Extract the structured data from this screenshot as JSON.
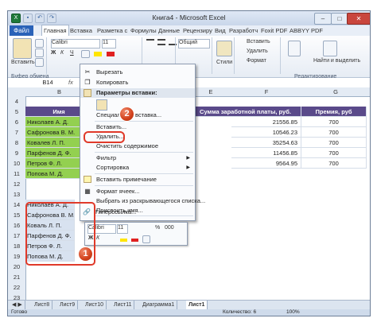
{
  "window": {
    "title": "Книга4 - Microsoft Excel"
  },
  "tabs": {
    "file": "Файл",
    "items": [
      "Главная",
      "Вставка",
      "Разметка с",
      "Формулы",
      "Данные",
      "Рецензиру",
      "Вид",
      "Разработч",
      "Foxit PDF",
      "ABBYY PDF"
    ],
    "active": "Главная"
  },
  "ribbon": {
    "paste_label": "Вставить",
    "clipboard_group": "Буфер обмена",
    "font_name": "Calibri",
    "font_size": "11",
    "number_format": "Общий",
    "styles_label": "Стили",
    "insert_label": "Вставить",
    "delete_label": "Удалить",
    "format_label": "Формат",
    "find_label": "Найти и выделить",
    "editing_group": "Редактирование"
  },
  "formula_bar": {
    "cell_ref": "B14"
  },
  "columns": [
    "B",
    "C",
    "D",
    "E",
    "F",
    "G"
  ],
  "rows": [
    "4",
    "5",
    "6",
    "7",
    "8",
    "9",
    "10",
    "11",
    "12",
    "13",
    "14",
    "15",
    "16",
    "17",
    "18",
    "19",
    "20",
    "21",
    "22",
    "23"
  ],
  "table": {
    "header_name": "Имя",
    "header_salary": "Сумма заработной платы, руб.",
    "header_bonus": "Премия, руб",
    "names": [
      "Николаев А. Д.",
      "Сафронова В. М.",
      "Ковалев Л. П.",
      "Парфенов Д. Ф.",
      "Петров Ф. Л.",
      "Попова М. Д."
    ],
    "salaries": [
      "21556.85",
      "10546.23",
      "35254.63",
      "11456.85",
      "9564.95"
    ],
    "bonuses": [
      "700",
      "700",
      "700",
      "700",
      "700"
    ]
  },
  "copied_names": [
    "Николаев А. Д.",
    "Сафронова В. М.",
    "Коваль Л. П.",
    "Парфенов Д. Ф.",
    "Петров Ф. Л.",
    "Попова М. Д."
  ],
  "context_menu": {
    "cut": "Вырезать",
    "copy": "Копировать",
    "paste_options": "Параметры вставки:",
    "paste_special": "Специальная вставка...",
    "insert": "Вставить...",
    "delete": "Удалить...",
    "clear": "Очистить содержимое",
    "filter": "Фильтр",
    "sort": "Сортировка",
    "insert_comment": "Вставить примечание",
    "format_cells": "Формат ячеек...",
    "pick_from_list": "Выбрать из раскрывающегося списка...",
    "define_name": "Присвоить имя...",
    "hyperlink": "Гиперссылка..."
  },
  "mini_toolbar": {
    "font": "Calibri",
    "size": "11",
    "percent": "%",
    "thousands": "000"
  },
  "callouts": {
    "one": "1",
    "two": "2"
  },
  "sheet_tabs": [
    "Лист8",
    "Лист9",
    "Лист10",
    "Лист11",
    "Диаграмма1",
    "Лист1"
  ],
  "active_sheet": "Лист1",
  "status": {
    "ready": "Готово",
    "count_label": "Количество: 6",
    "zoom": "100%"
  },
  "colors": {
    "header": "#5a4a8a",
    "name_fill": "#93d050",
    "selection": "#e03a2a",
    "file_tab": "#2a62b8"
  },
  "icons": [
    "save-icon",
    "undo-icon",
    "redo-icon",
    "cut-icon",
    "copy-icon",
    "paste-icon",
    "chevron-right-icon",
    "comment-icon",
    "format-cells-icon",
    "hyperlink-icon",
    "bold-icon",
    "italic-icon",
    "fill-color-icon",
    "font-color-icon",
    "borders-icon"
  ]
}
